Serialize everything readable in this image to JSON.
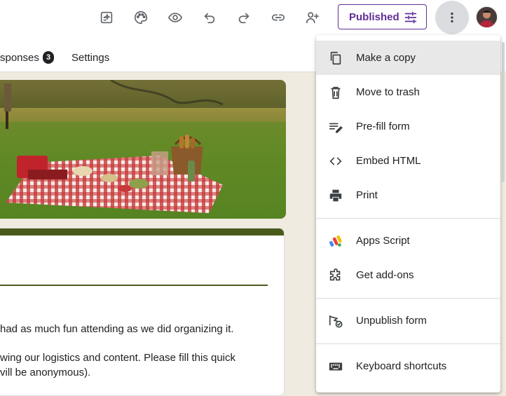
{
  "toolbar": {
    "icons": [
      "customize-ai-icon",
      "palette-icon",
      "preview-eye-icon",
      "undo-icon",
      "redo-icon",
      "link-icon",
      "add-collaborator-icon"
    ],
    "published_label": "Published",
    "more_icon": "more-vert-icon"
  },
  "tabs": {
    "responses_label": "sponses",
    "responses_count": "3",
    "settings_label": "Settings"
  },
  "form": {
    "desc_line1": "had as much fun attending as we did organizing it.",
    "desc_line2": "wing our logistics and content. Please fill this quick",
    "desc_line3": "vill be anonymous)."
  },
  "menu": {
    "items": [
      {
        "label": "Make a copy",
        "icon": "copy-icon"
      },
      {
        "label": "Move to trash",
        "icon": "trash-icon"
      },
      {
        "label": "Pre-fill form",
        "icon": "edit-note-icon"
      },
      {
        "label": "Embed HTML",
        "icon": "code-icon"
      },
      {
        "label": "Print",
        "icon": "print-icon"
      },
      {
        "label": "Apps Script",
        "icon": "apps-script-icon"
      },
      {
        "label": "Get add-ons",
        "icon": "extension-icon"
      },
      {
        "label": "Unpublish form",
        "icon": "unpublish-icon"
      },
      {
        "label": "Keyboard shortcuts",
        "icon": "keyboard-icon"
      }
    ]
  },
  "colors": {
    "accent": "#5f2f96",
    "theme": "#4a5a1a",
    "background": "#f0ebe0"
  }
}
